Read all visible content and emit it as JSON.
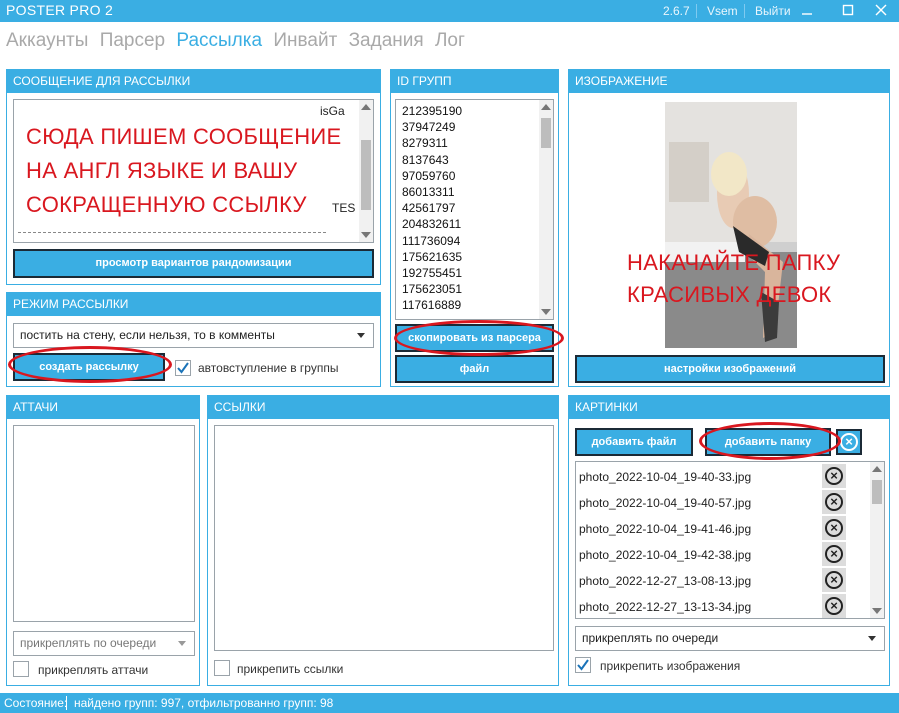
{
  "app": {
    "title": "POSTER PRO 2",
    "version": "2.6.7",
    "user": "Vsem",
    "logout": "Выйти"
  },
  "nav": {
    "tabs": [
      "Аккаунты",
      "Парсер",
      "Рассылка",
      "Инвайт",
      "Задания",
      "Лог"
    ],
    "active": "Рассылка"
  },
  "message_panel": {
    "header": "СООБЩЕНИЕ ДЛЯ РАССЫЛКИ",
    "visible_fragment_1": "isGa",
    "visible_fragment_2": "TES",
    "preview_button": "просмотр вариантов рандомизации"
  },
  "mode_panel": {
    "header": "РЕЖИМ РАССЫЛКИ",
    "mode_value": "постить на стену, если нельзя, то в комменты",
    "create_button": "создать рассылку",
    "auto_join_label": "автовступление в группы",
    "auto_join_checked": true
  },
  "ids_panel": {
    "header": "ID ГРУПП",
    "ids": [
      "212395190",
      "37947249",
      "8279311",
      "8137643",
      "97059760",
      "86013311",
      "42561797",
      "204832611",
      "111736094",
      "175621635",
      "192755451",
      "175623051",
      "117616889"
    ],
    "copy_button": "скопировать из парсера",
    "file_button": "файл"
  },
  "image_panel": {
    "header": "ИЗОБРАЖЕНИЕ",
    "settings_button": "настройки изображений"
  },
  "attachments_panel": {
    "header": "АТТАЧИ",
    "order_value": "прикреплять по очереди",
    "attach_label": "прикреплять аттачи",
    "attach_checked": false
  },
  "links_panel": {
    "header": "ССЫЛКИ",
    "attach_label": "прикрепить ссылки",
    "attach_checked": false
  },
  "pictures_panel": {
    "header": "КАРТИНКИ",
    "add_file_button": "добавить файл",
    "add_folder_button": "добавить папку",
    "files": [
      "photo_2022-10-04_19-40-33.jpg",
      "photo_2022-10-04_19-40-57.jpg",
      "photo_2022-10-04_19-41-46.jpg",
      "photo_2022-10-04_19-42-38.jpg",
      "photo_2022-12-27_13-08-13.jpg",
      "photo_2022-12-27_13-13-34.jpg"
    ],
    "order_value": "прикреплять по очереди",
    "attach_label": "прикрепить изображения",
    "attach_checked": true
  },
  "annotations": {
    "message_note": [
      "СЮДА ПИШЕМ СООБЩЕНИЕ",
      "НА АНГЛ ЯЗЫКЕ И ВАШУ",
      "СОКРАЩЕННУЮ ССЫЛКУ"
    ],
    "image_note": [
      "НАКАЧАЙТЕ ПАПКУ",
      "КРАСИВЫХ ДЕВОК"
    ]
  },
  "status": {
    "label": "Состояние:",
    "text": "найдено групп: 997, отфильтрованно групп: 98"
  },
  "colors": {
    "accent": "#3aaee3",
    "annotation_red": "#d9171f",
    "button_border": "#1b2a36"
  }
}
